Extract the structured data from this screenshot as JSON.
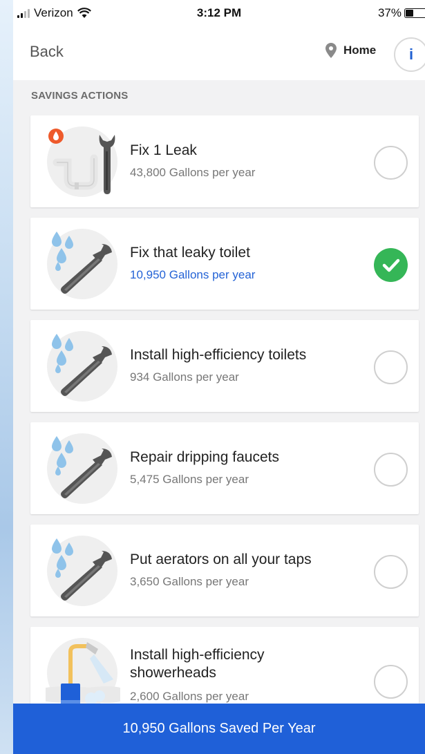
{
  "status_bar": {
    "carrier": "Verizon",
    "time": "3:12 PM",
    "battery_percent": "37%",
    "battery_level": 0.37
  },
  "nav": {
    "back_label": "Back",
    "location_label": "Home",
    "info_label": "i"
  },
  "section_title": "SAVINGS ACTIONS",
  "actions": [
    {
      "title": "Fix 1 Leak",
      "subtitle": "43,800 Gallons per year",
      "checked": false,
      "icon": "leak-pipe-icon"
    },
    {
      "title": "Fix that leaky toilet",
      "subtitle": "10,950 Gallons per year",
      "checked": true,
      "icon": "wrench-water-icon"
    },
    {
      "title": "Install high-efficiency toilets",
      "subtitle": "934 Gallons per year",
      "checked": false,
      "icon": "wrench-water-icon"
    },
    {
      "title": "Repair dripping faucets",
      "subtitle": "5,475 Gallons per year",
      "checked": false,
      "icon": "wrench-water-icon"
    },
    {
      "title": "Put aerators on all your taps",
      "subtitle": "3,650 Gallons per year",
      "checked": false,
      "icon": "wrench-water-icon"
    },
    {
      "title_line1": "Install high-efficiency",
      "title_line2": "showerheads",
      "subtitle": "2,600 Gallons per year",
      "checked": false,
      "icon": "showerhead-icon"
    }
  ],
  "footer": {
    "summary": "10,950 Gallons Saved Per Year"
  },
  "colors": {
    "accent": "#1f60d8",
    "check_green": "#35b657",
    "active_subtitle": "#2463d6"
  }
}
